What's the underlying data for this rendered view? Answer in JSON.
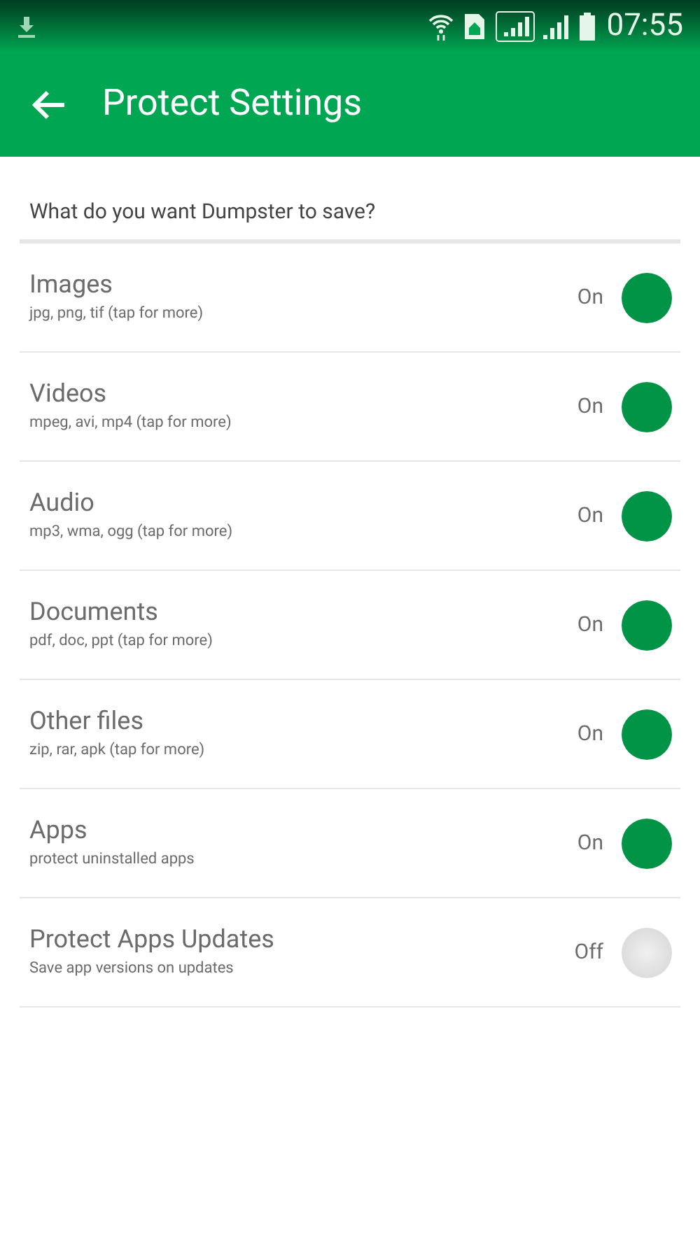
{
  "status_bar": {
    "time": "07:55"
  },
  "app_bar": {
    "title": "Protect Settings"
  },
  "section_header": "What do you want Dumpster to save?",
  "settings": [
    {
      "title": "Images",
      "subtitle": "jpg, png, tif (tap for more)",
      "state_label": "On",
      "on": true
    },
    {
      "title": "Videos",
      "subtitle": "mpeg, avi, mp4 (tap for more)",
      "state_label": "On",
      "on": true
    },
    {
      "title": "Audio",
      "subtitle": "mp3, wma, ogg (tap for more)",
      "state_label": "On",
      "on": true
    },
    {
      "title": "Documents",
      "subtitle": "pdf, doc, ppt (tap for more)",
      "state_label": "On",
      "on": true
    },
    {
      "title": "Other files",
      "subtitle": "zip, rar, apk (tap for more)",
      "state_label": "On",
      "on": true
    },
    {
      "title": "Apps",
      "subtitle": "protect uninstalled apps",
      "state_label": "On",
      "on": true
    },
    {
      "title": "Protect Apps Updates",
      "subtitle": "Save app versions on updates",
      "state_label": "Off",
      "on": false
    }
  ]
}
